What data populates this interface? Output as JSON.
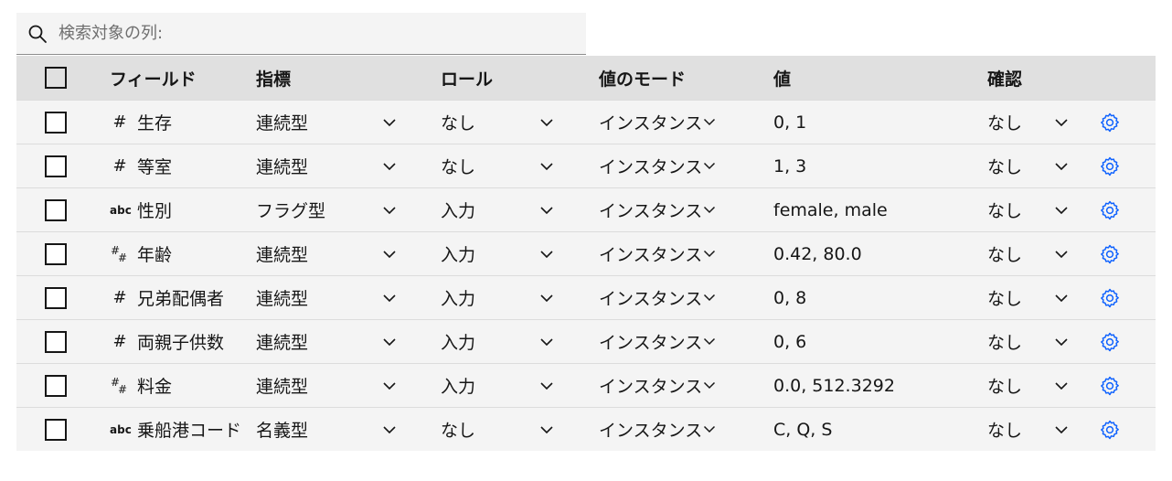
{
  "search": {
    "placeholder": "検索対象の列:"
  },
  "headers": {
    "field": "フィールド",
    "measure": "指標",
    "role": "ロール",
    "mode": "値のモード",
    "values": "値",
    "check": "確認"
  },
  "rows": [
    {
      "type_icon": "hash-icon",
      "field": "生存",
      "measure": "連続型",
      "role": "なし",
      "mode": "インスタンス",
      "values": "0, 1",
      "check": "なし"
    },
    {
      "type_icon": "hash-icon",
      "field": "等室",
      "measure": "連続型",
      "role": "なし",
      "mode": "インスタンス",
      "values": "1, 3",
      "check": "なし"
    },
    {
      "type_icon": "abc-icon",
      "field": "性別",
      "measure": "フラグ型",
      "role": "入力",
      "mode": "インスタンス",
      "values": "female, male",
      "check": "なし"
    },
    {
      "type_icon": "continuous-icon",
      "field": "年齢",
      "measure": "連続型",
      "role": "入力",
      "mode": "インスタンス",
      "values": "0.42, 80.0",
      "check": "なし"
    },
    {
      "type_icon": "hash-icon",
      "field": "兄弟配偶者",
      "measure": "連続型",
      "role": "入力",
      "mode": "インスタンス",
      "values": "0, 8",
      "check": "なし"
    },
    {
      "type_icon": "hash-icon",
      "field": "両親子供数",
      "measure": "連続型",
      "role": "入力",
      "mode": "インスタンス",
      "values": "0, 6",
      "check": "なし"
    },
    {
      "type_icon": "continuous-icon",
      "field": "料金",
      "measure": "連続型",
      "role": "入力",
      "mode": "インスタンス",
      "values": "0.0, 512.3292",
      "check": "なし"
    },
    {
      "type_icon": "abc-icon",
      "field": "乗船港コード",
      "measure": "名義型",
      "role": "なし",
      "mode": "インスタンス",
      "values": "C, Q, S",
      "check": "なし"
    }
  ],
  "type_icon_glyphs": {
    "abc": "abc",
    "hash": "#"
  },
  "colors": {
    "accent": "#0f62fe",
    "header_bg": "#e0e0e0",
    "row_bg": "#f4f4f4"
  }
}
